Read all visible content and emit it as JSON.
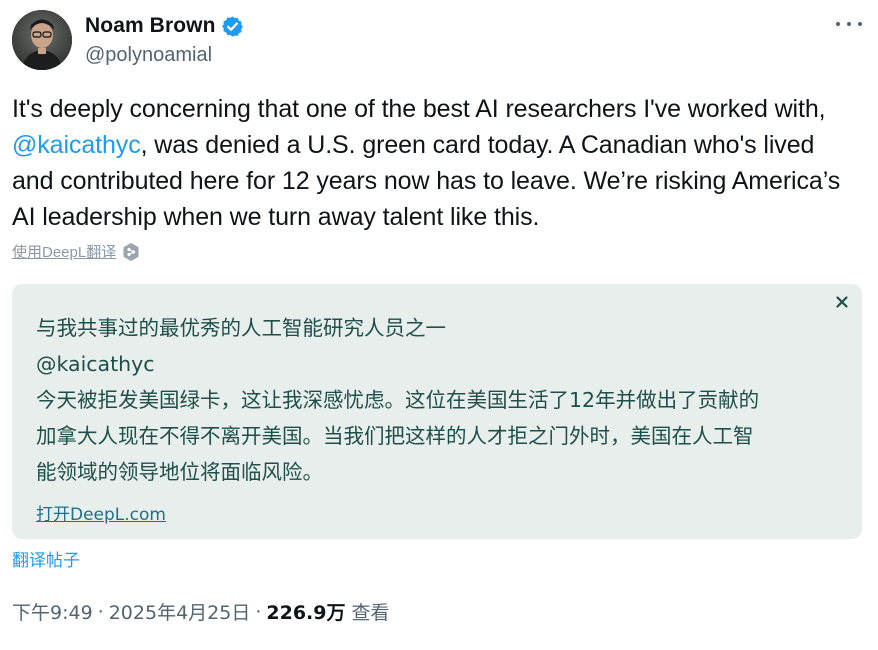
{
  "author": {
    "name": "Noam Brown",
    "handle": "@polynoamial",
    "verified": true
  },
  "tweet": {
    "part1": "It's deeply concerning that one of the best AI researchers I've worked with, ",
    "mention": "@kaicathyc",
    "part2": ", was denied a U.S. green card today. A Canadian who's lived and contributed here for 12 years now has to leave. We’re risking America’s AI leadership when we turn away talent like this."
  },
  "deepl_translate_label": "使用DeepL翻译",
  "translation": {
    "lines": [
      "与我共事过的最优秀的人工智能研究人员之一",
      "@kaicathyc",
      "今天被拒发美国绿卡，这让我深感忧虑。这位在美国生活了12年并做出了贡献的",
      "加拿大人现在不得不离开美国。当我们把这样的人才拒之门外时，美国在人工智",
      "能领域的领导地位将面临风险。"
    ],
    "open_link": "打开DeepL.com"
  },
  "translate_post_label": "翻译帖子",
  "meta": {
    "time": "下午9:49",
    "separator": "·",
    "date": "2025年4月25日",
    "views_count": "226.9万",
    "views_label": "查看"
  },
  "colors": {
    "accent": "#1d9bf0",
    "translation_bg": "#e7eeeb",
    "translation_text": "#1f4f4a"
  },
  "icons": {
    "verified": "verified-badge-icon",
    "more": "more-options-icon",
    "deepl": "deepl-logo-icon",
    "close": "close-icon"
  }
}
